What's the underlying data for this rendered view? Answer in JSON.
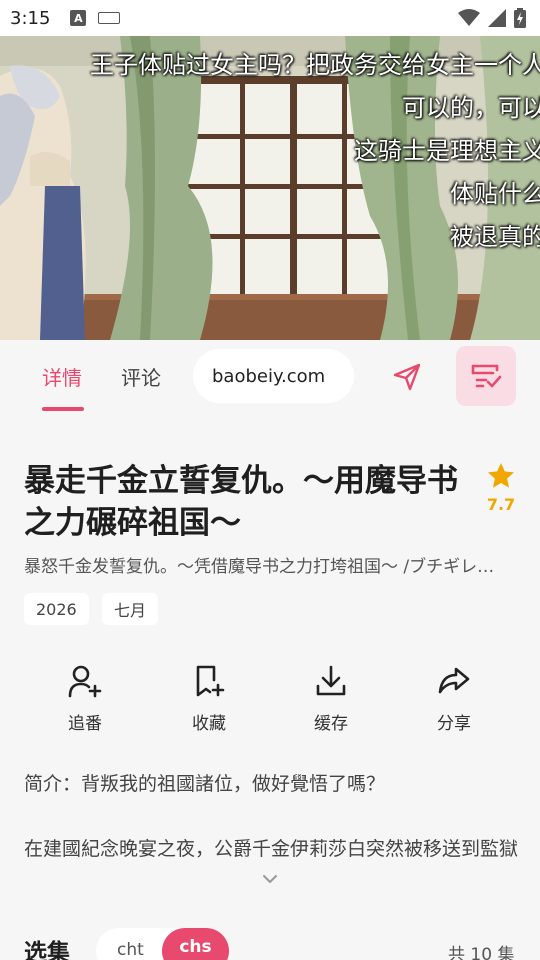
{
  "status_bar": {
    "time": "3:15",
    "notification_icon": "A",
    "icons": [
      "keyboard-icon",
      "wifi-icon",
      "signal-icon",
      "battery-charging-icon"
    ]
  },
  "player": {
    "subtitles": [
      "王子体贴过女主吗？把政务交给女主一个人",
      "可以的，可以",
      "这骑士是理想主义",
      "体贴什么",
      "被退真的"
    ]
  },
  "tabs": {
    "detail": "详情",
    "comments": "评论",
    "danmaku_text": "baobeiy.com"
  },
  "anime": {
    "title": "暴走千金立誓复仇。～用魔导书之力碾碎祖国～",
    "rating": "7.7",
    "alt_title": "暴怒千金发誓复仇。～凭借魔导书之力打垮祖国～ /ブチギレ令嬢は誓いました",
    "tags": [
      "2026",
      "七月"
    ]
  },
  "actions": [
    {
      "label": "追番",
      "icon": "follow-icon"
    },
    {
      "label": "收藏",
      "icon": "bookmark-add-icon"
    },
    {
      "label": "缓存",
      "icon": "download-icon"
    },
    {
      "label": "分享",
      "icon": "share-icon"
    }
  ],
  "description": {
    "line1": "简介：背叛我的祖國諸位，做好覺悟了嗎？",
    "line2": "在建國紀念晚宴之夜，公爵千金伊莉莎白突然被移送到監獄"
  },
  "episodes": {
    "title": "选集",
    "lang_cht": "cht",
    "lang_chs": "chs",
    "count": "共 10 集"
  },
  "colors": {
    "accent": "#e8496f",
    "star": "#f0a800",
    "background": "#f6f6f6"
  }
}
